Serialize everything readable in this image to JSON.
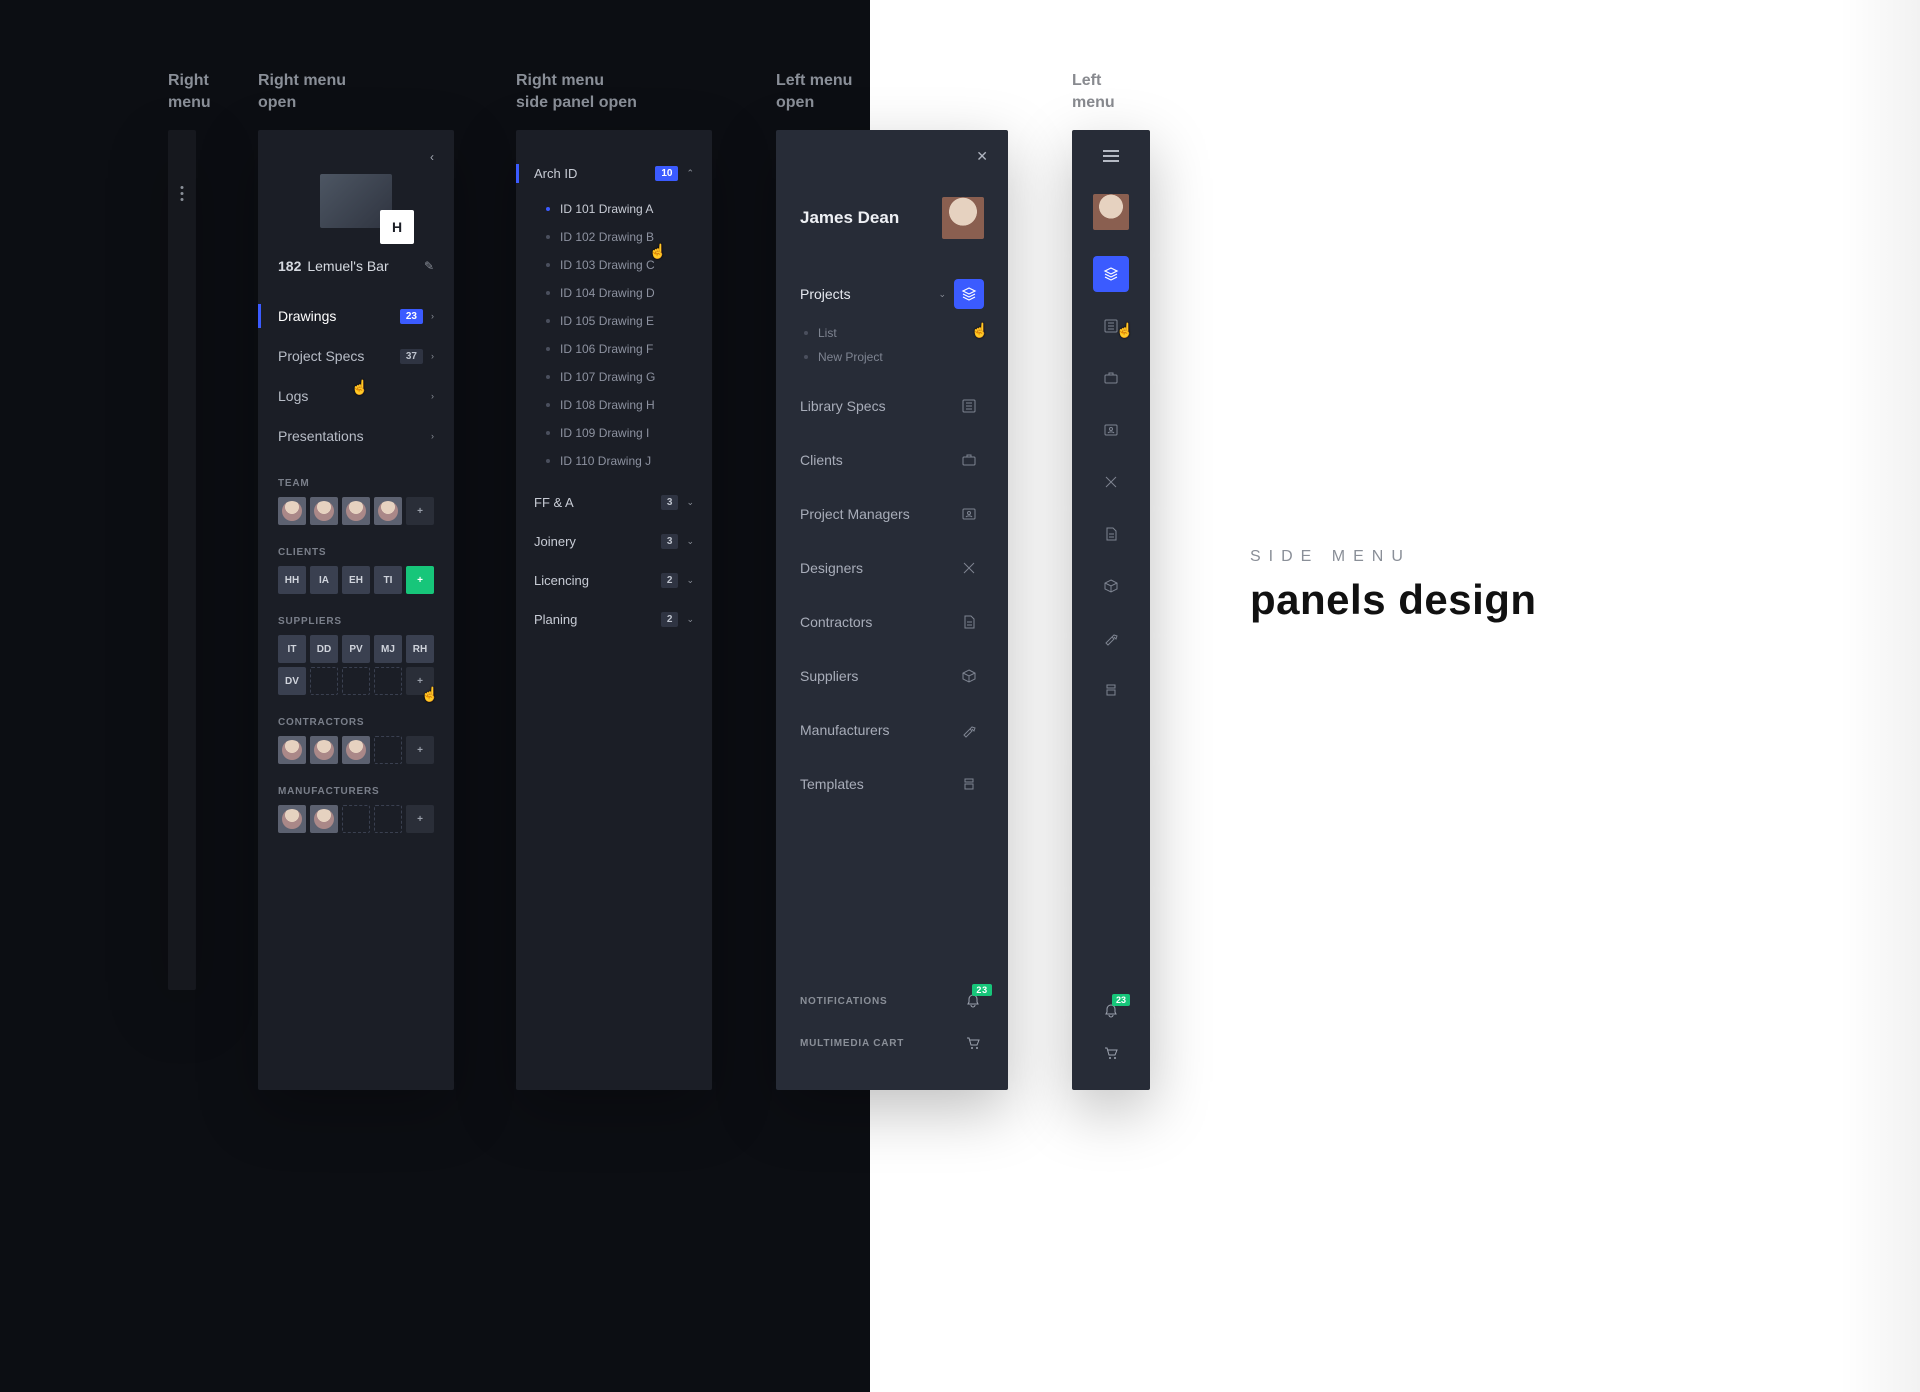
{
  "labels": {
    "p1": "Right\nmenu",
    "p2": "Right menu\nopen",
    "p3": "Right menu\nside panel open",
    "p4": "Left menu\nopen",
    "p5": "Left\nmenu"
  },
  "title": {
    "eyebrow": "SIDE MENU",
    "main": "panels design"
  },
  "project": {
    "code": "182",
    "name": "Lemuel's Bar",
    "logo_letter": "H"
  },
  "nav": [
    {
      "label": "Drawings",
      "count": "23",
      "active": true
    },
    {
      "label": "Project Specs",
      "count": "37",
      "active": false
    },
    {
      "label": "Logs",
      "count": null,
      "active": false
    },
    {
      "label": "Presentations",
      "count": null,
      "active": false
    }
  ],
  "groups": {
    "team_hdr": "TEAM",
    "clients_hdr": "CLIENTS",
    "clients": [
      "HH",
      "IA",
      "EH",
      "TI"
    ],
    "suppliers_hdr": "SUPPLIERS",
    "suppliers": [
      "IT",
      "DD",
      "PV",
      "MJ",
      "RH",
      "DV"
    ],
    "contractors_hdr": "CONTRACTORS",
    "manufacturers_hdr": "MANUFACTURERS"
  },
  "sections": [
    {
      "label": "Arch ID",
      "count": "10",
      "active": true,
      "expanded": true,
      "items": [
        "ID 101 Drawing A",
        "ID 102 Drawing B",
        "ID 103 Drawing C",
        "ID 104 Drawing D",
        "ID 105 Drawing E",
        "ID 106 Drawing F",
        "ID 107 Drawing G",
        "ID 108 Drawing H",
        "ID 109 Drawing I",
        "ID 110 Drawing J"
      ]
    },
    {
      "label": "FF & A",
      "count": "3"
    },
    {
      "label": "Joinery",
      "count": "3"
    },
    {
      "label": "Licencing",
      "count": "2"
    },
    {
      "label": "Planing",
      "count": "2"
    }
  ],
  "left": {
    "user": "James Dean",
    "projects_label": "Projects",
    "projects_sub": [
      "List",
      "New Project"
    ],
    "items": [
      {
        "label": "Library Specs",
        "icon": "list-icon"
      },
      {
        "label": "Clients",
        "icon": "briefcase-icon"
      },
      {
        "label": "Project Managers",
        "icon": "id-card-icon"
      },
      {
        "label": "Designers",
        "icon": "ruler-icon"
      },
      {
        "label": "Contractors",
        "icon": "note-icon"
      },
      {
        "label": "Suppliers",
        "icon": "box-icon"
      },
      {
        "label": "Manufacturers",
        "icon": "hammer-icon"
      },
      {
        "label": "Templates",
        "icon": "template-icon"
      }
    ],
    "bottom": {
      "notifications": "NOTIFICATIONS",
      "notif_count": "23",
      "cart": "MULTIMEDIA CART"
    }
  }
}
